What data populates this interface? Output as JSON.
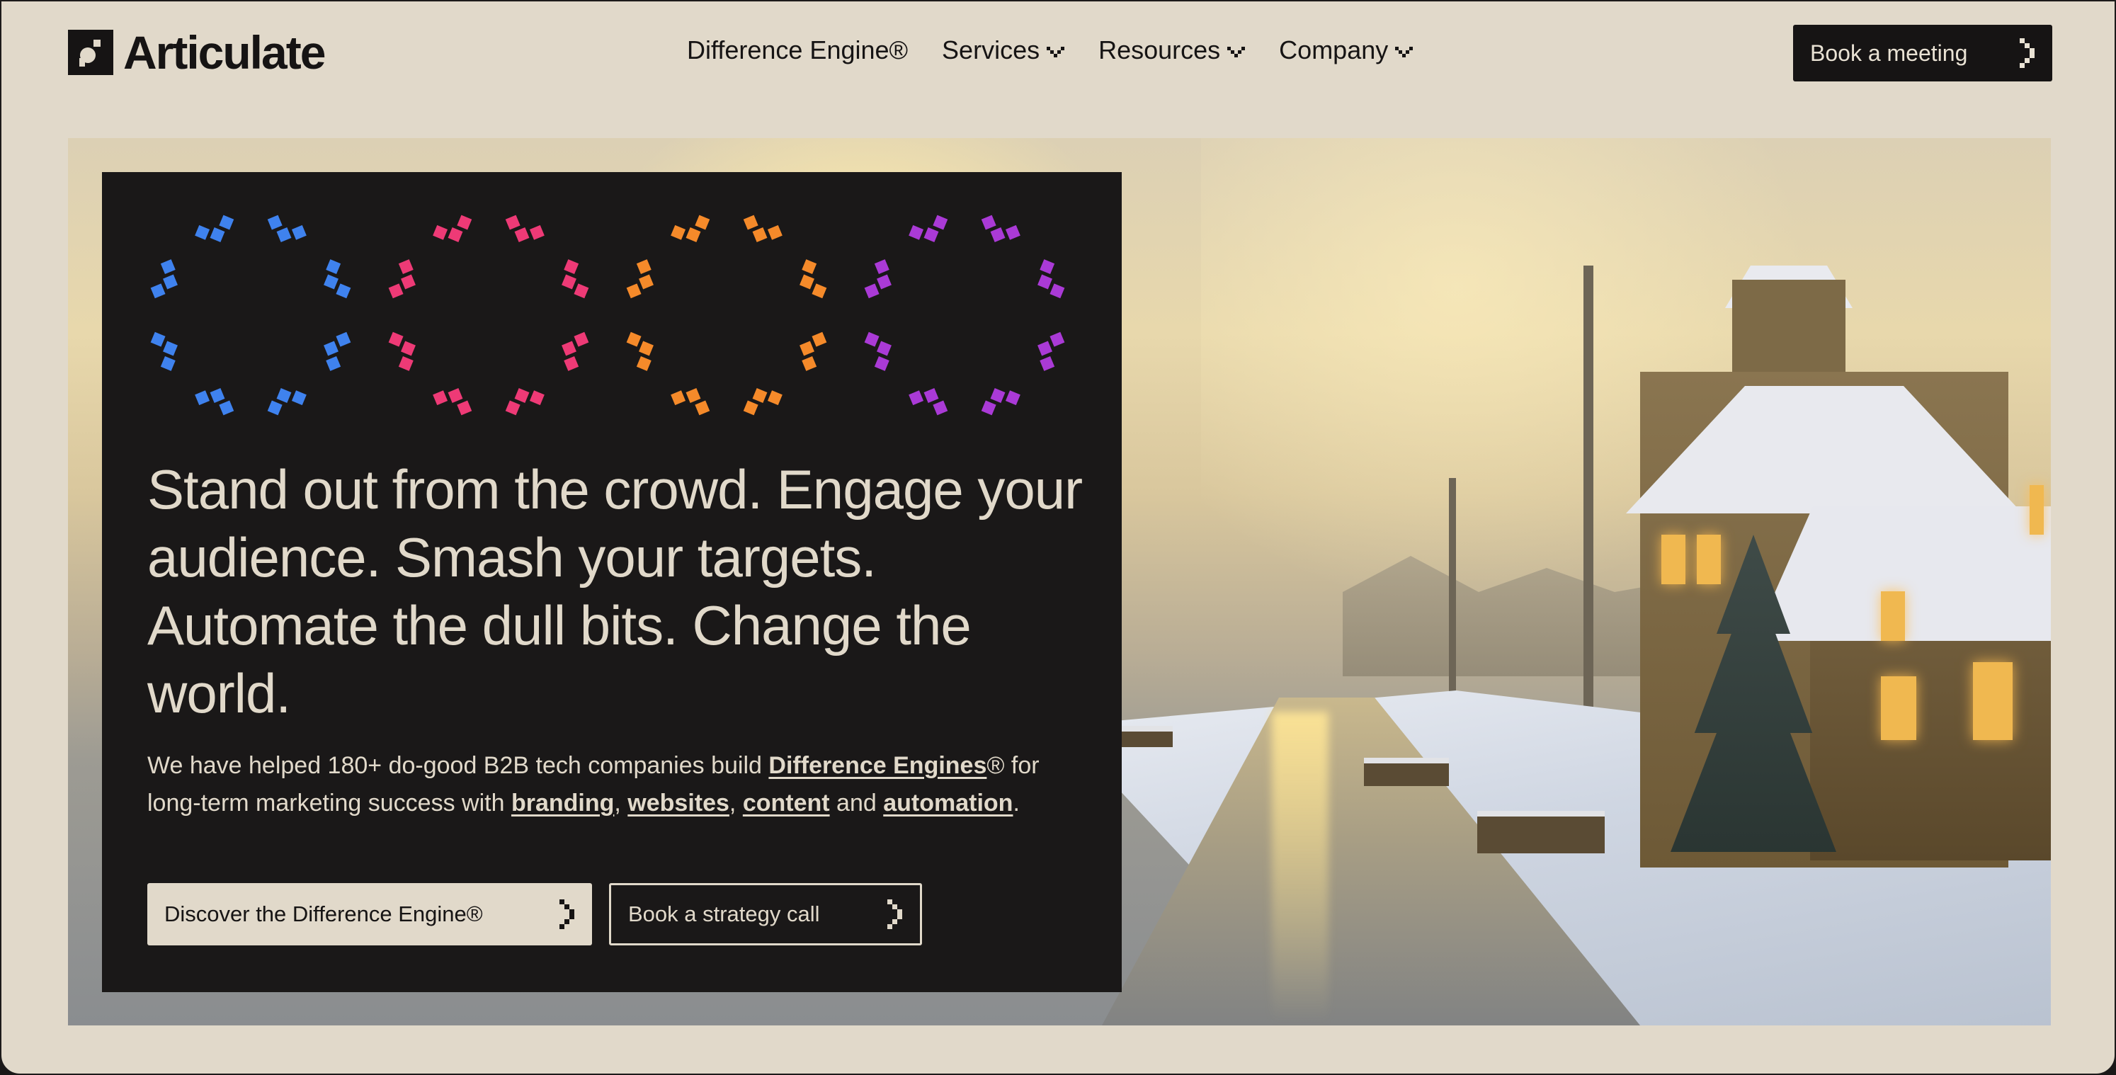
{
  "header": {
    "logo_text": "Articulate",
    "nav": [
      {
        "label": "Difference Engine®",
        "has_dropdown": false
      },
      {
        "label": "Services",
        "has_dropdown": true
      },
      {
        "label": "Resources",
        "has_dropdown": true
      },
      {
        "label": "Company",
        "has_dropdown": true
      }
    ],
    "cta_label": "Book a meeting"
  },
  "hero": {
    "ring_colors": [
      "#3f82ee",
      "#ee3a76",
      "#f58a2a",
      "#aa3ad6"
    ],
    "headline": "Stand out from the crowd. Engage your audience. Smash your targets. Automate the dull bits. Change the world.",
    "body": {
      "t1": "We have helped 180+ do-good B2B tech companies build ",
      "link_difference_engines": "Difference Engines",
      "t2": "® for long-term marketing success with ",
      "link_branding": "branding",
      "sep1": ", ",
      "link_websites": "websites",
      "sep2": ", ",
      "link_content": "content",
      "t3": " and ",
      "link_automation": "automation",
      "t4": "."
    },
    "primary_button": "Discover the Difference Engine®",
    "secondary_button": "Book a strategy call"
  },
  "colors": {
    "background": "#e1d9ca",
    "ink": "#161414"
  }
}
